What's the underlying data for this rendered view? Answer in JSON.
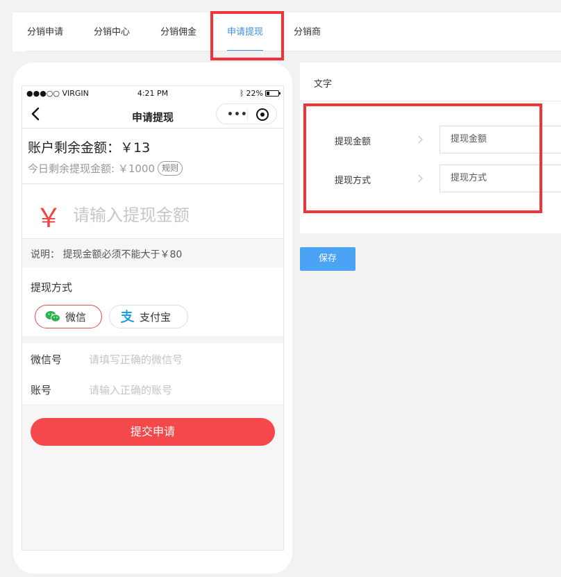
{
  "tabs": [
    {
      "label": "分销申请"
    },
    {
      "label": "分销中心"
    },
    {
      "label": "分销佣金"
    },
    {
      "label": "申请提现",
      "active": true
    },
    {
      "label": "分销商"
    }
  ],
  "phone": {
    "status": {
      "carrier": "●●●○○ VIRGIN",
      "time": "4:21 PM",
      "battery": "22%"
    },
    "nav_title": "申请提现",
    "balance": {
      "text": "账户剩余金额：￥13",
      "today": "今日剩余提现金额: ￥1000",
      "rule_label": "规则"
    },
    "amount": {
      "symbol": "￥",
      "placeholder": "请输入提现金额"
    },
    "note": "说明： 提现金额必须不能大于￥80",
    "method": {
      "title": "提现方式",
      "options": [
        {
          "label": "微信",
          "icon": "wechat-icon",
          "selected": true
        },
        {
          "label": "支付宝",
          "icon": "alipay-icon",
          "selected": false
        }
      ]
    },
    "fields": [
      {
        "label": "微信号",
        "placeholder": "请填写正确的微信号"
      },
      {
        "label": "账号",
        "placeholder": "请输入正确的账号"
      }
    ],
    "submit_label": "提交申请"
  },
  "panel": {
    "title": "文字",
    "rows": [
      {
        "label": "提现金额",
        "value": "提现金额"
      },
      {
        "label": "提现方式",
        "value": "提现方式"
      }
    ]
  },
  "save_label": "保存",
  "colors": {
    "accent": "#3d8fe0",
    "highlight": "#f0343a",
    "primary_red": "#f5484a",
    "save_blue": "#4aa3f5"
  }
}
